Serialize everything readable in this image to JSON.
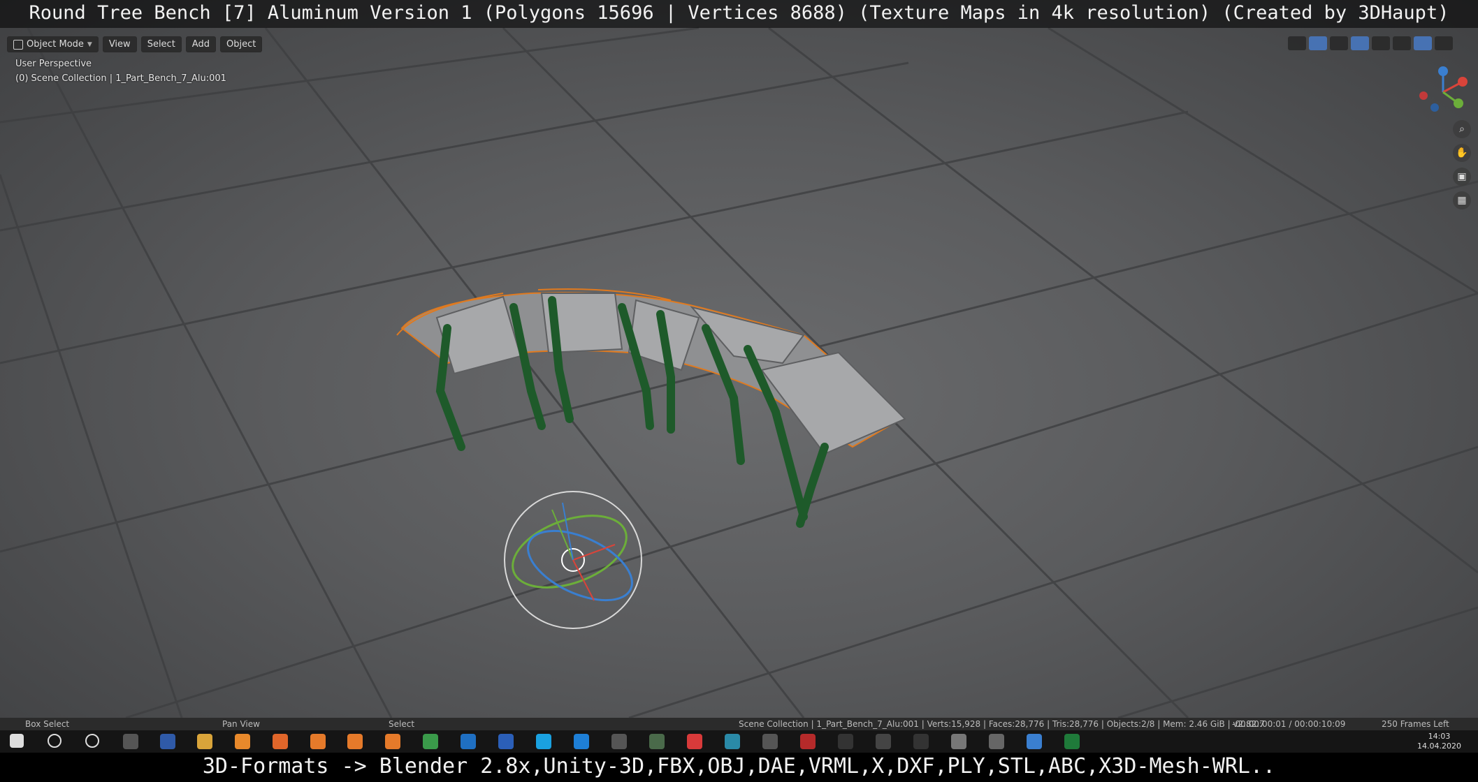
{
  "caption_top": "Round Tree Bench [7] Aluminum Version 1 (Polygons 15696 | Vertices 8688) (Texture Maps in 4k resolution) (Created by 3DHaupt)",
  "caption_bottom": "3D-Formats -> Blender 2.8x,Unity-3D,FBX,OBJ,DAE,VRML,X,DXF,PLY,STL,ABC,X3D-Mesh-WRL..",
  "header": {
    "mode": "Object Mode",
    "menus": [
      "View",
      "Select",
      "Add",
      "Object"
    ]
  },
  "viewport": {
    "perspective": "User Perspective",
    "collection": "(0) Scene Collection | 1_Part_Bench_7_Alu:001"
  },
  "statusbar": {
    "box_select": "Box Select",
    "pan_view": "Pan View",
    "select": "Select",
    "scene_info": "Scene Collection | 1_Part_Bench_7_Alu:001 | Verts:15,928 | Faces:28,776 | Tris:28,776 | Objects:2/8 | Mem: 2.46 GiB | v2.82.7",
    "timecode": "-00:00:00:01 / 00:00:10:09",
    "frames_left": "250 Frames Left"
  },
  "taskbar": {
    "time": "14:03",
    "date": "14.04.2020"
  },
  "colors": {
    "bench_frame": "#1e5a2a",
    "seat": "#9c9d9f",
    "selection": "#e07a1f",
    "accent": "#4772b3"
  }
}
